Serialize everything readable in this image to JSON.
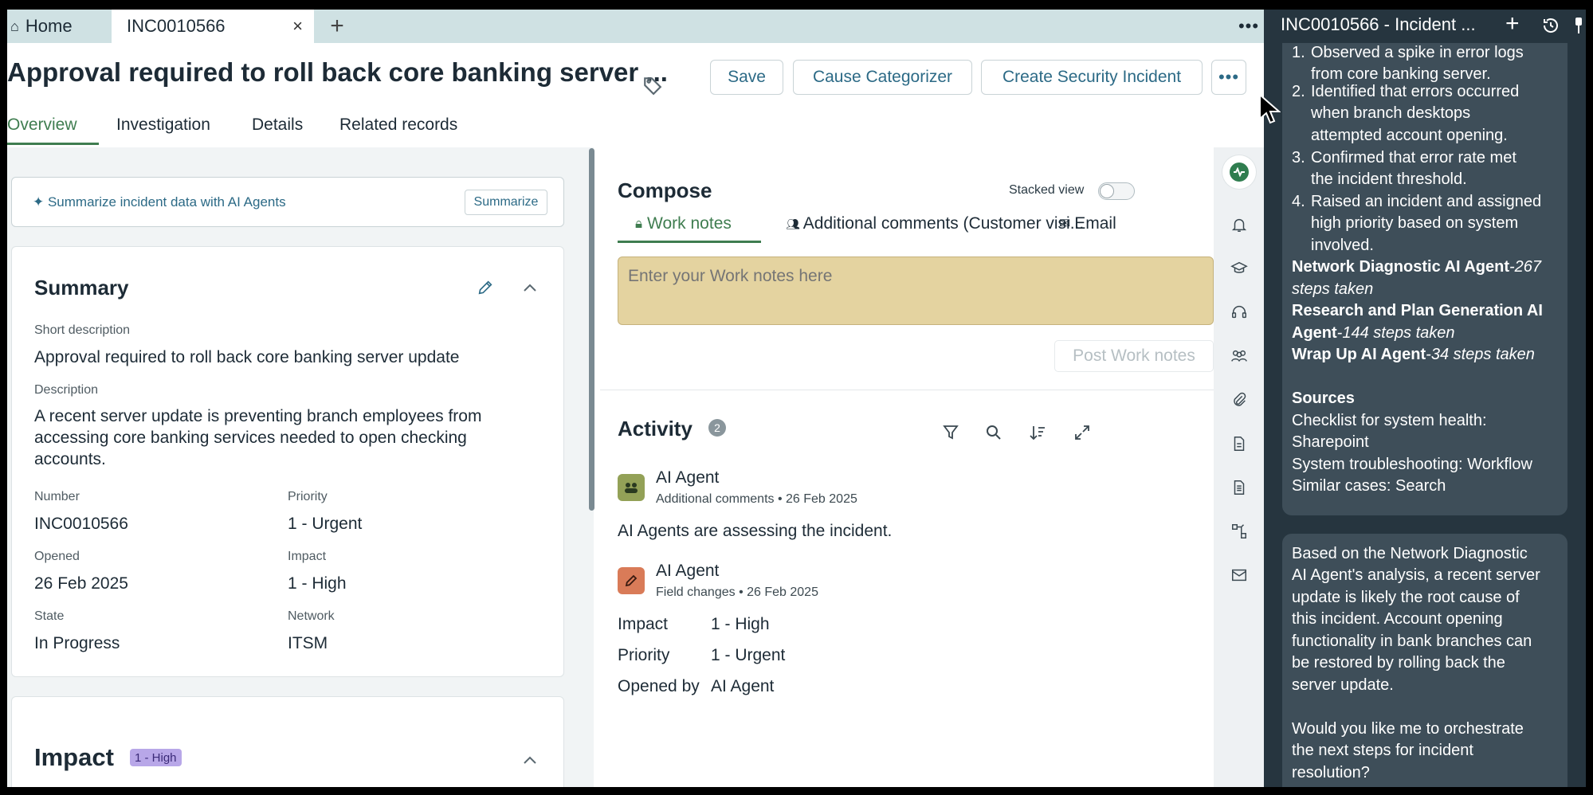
{
  "tabs": {
    "home": "Home",
    "incident": "INC0010566",
    "close": "×",
    "new_tab": "+",
    "more": "•••"
  },
  "header": {
    "title": "Approval required to roll back core banking server ...",
    "buttons": {
      "save": "Save",
      "cause_categorizer": "Cause Categorizer",
      "create_security_incident": "Create Security Incident",
      "more": "•••"
    }
  },
  "subtabs": [
    "Overview",
    "Investigation",
    "Details",
    "Related records"
  ],
  "ai_summarize": {
    "text": "Summarize incident data with AI Agents",
    "button": "Summarize"
  },
  "summary": {
    "title": "Summary",
    "short_description_label": "Short description",
    "short_description": "Approval required to roll back core banking server update",
    "description_label": "Description",
    "description": "A recent server update is preventing branch employees from accessing core banking services needed to open checking accounts.",
    "number_label": "Number",
    "number": "INC0010566",
    "priority_label": "Priority",
    "priority": "1 - Urgent",
    "opened_label": "Opened",
    "opened": "26 Feb 2025",
    "impact_label": "Impact",
    "impact": "1 - High",
    "state_label": "State",
    "state": "In Progress",
    "network_label": "Network",
    "network": "ITSM"
  },
  "impact_section": {
    "title": "Impact",
    "badge": "1 - High"
  },
  "compose": {
    "title": "Compose",
    "stacked_view_label": "Stacked view",
    "tabs": {
      "work_notes": "Work notes",
      "additional_comments": "Additional comments (Customer visi...",
      "email": "Email"
    },
    "work_notes_placeholder": "Enter your Work notes here",
    "post_button": "Post Work notes"
  },
  "activity": {
    "title": "Activity",
    "count": "2",
    "entries": [
      {
        "author": "AI Agent",
        "meta": "Additional comments • 26 Feb 2025",
        "text": "AI Agents are assessing the incident."
      },
      {
        "author": "AI Agent",
        "meta": "Field changes • 26 Feb 2025",
        "changes": [
          {
            "label": "Impact",
            "value": "1 - High"
          },
          {
            "label": "Priority",
            "value": "1 - Urgent"
          },
          {
            "label": "Opened by",
            "value": "AI Agent"
          }
        ]
      }
    ]
  },
  "assistant": {
    "title": "INC0010566 - Incident ...",
    "new": "+",
    "steps": [
      {
        "num": "1.",
        "lines": [
          "Observed a spike in error logs",
          "from core banking server."
        ]
      },
      {
        "num": "2.",
        "lines": [
          "Identified that errors occurred",
          "when branch desktops",
          "attempted account opening."
        ]
      },
      {
        "num": "3.",
        "lines": [
          "Confirmed that error rate met",
          "the incident threshold."
        ]
      },
      {
        "num": "4.",
        "lines": [
          "Raised an incident and assigned",
          "high priority based on system",
          "involved."
        ]
      }
    ],
    "agents": [
      {
        "name": "Network Diagnostic AI Agent",
        "steps": "-267",
        "steps_cont": "steps taken"
      },
      {
        "name": "Research and Plan Generation AI",
        "name_cont": "Agent",
        "steps": "-144 steps taken"
      },
      {
        "name": "Wrap Up AI Agent",
        "steps": "-34 steps taken"
      }
    ],
    "sources_title": "Sources",
    "sources": [
      "Checklist for system health:",
      "Sharepoint",
      "System troubleshooting: Workflow",
      "Similar cases: Search"
    ],
    "message_lines": [
      "Based on the Network Diagnostic",
      "AI Agent's analysis, a recent server",
      "update is likely the root cause of",
      "this incident. Account opening",
      "functionality in bank branches can",
      "be restored by rolling back the",
      "server update."
    ],
    "question_lines": [
      "Would you like me to orchestrate",
      "the next steps for incident",
      "resolution?"
    ]
  },
  "colors": {
    "accent_green": "#3f7d50",
    "link_blue": "#2c6a86",
    "assistant_bg": "#26353f",
    "work_notes_bg": "#e4d3a0"
  }
}
